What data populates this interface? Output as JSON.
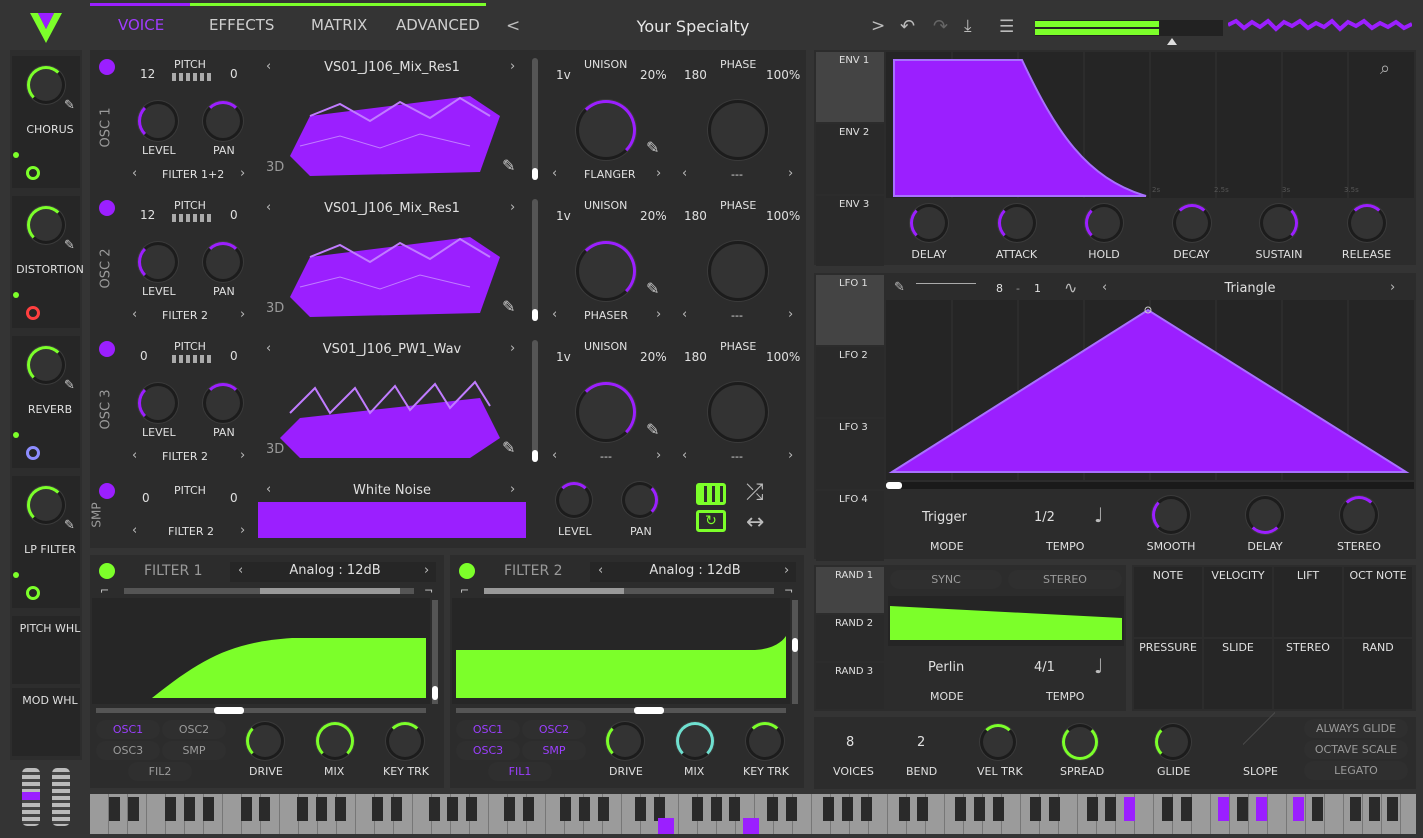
{
  "app": {
    "accent": "#9b1fff",
    "green": "#7cff2a"
  },
  "tabs": [
    "VOICE",
    "EFFECTS",
    "MATRIX",
    "ADVANCED"
  ],
  "preset": {
    "name": "Your Specialty"
  },
  "sidebar": [
    {
      "label": "CHORUS",
      "led": "#7cff2a"
    },
    {
      "label": "DISTORTION",
      "led": "#ff3f3f"
    },
    {
      "label": "REVERB",
      "led": "#8d8dff"
    },
    {
      "label": "LP FILTER",
      "led": "#7cff2a"
    },
    {
      "label": "PITCH WHL"
    },
    {
      "label": "MOD WHL"
    }
  ],
  "oscs": [
    {
      "name": "OSC 1",
      "pitch_left": "12",
      "pitch_right": "0",
      "pitch": "PITCH",
      "level": "LEVEL",
      "pan": "PAN",
      "filter": "FILTER 1+2",
      "wavetable": "VS01_J106_Mix_Res1",
      "view": "3D",
      "unison_voices": "1v",
      "unison": "UNISON",
      "unison_detune": "20%",
      "phase_val": "180",
      "phase": "PHASE",
      "phase_rand": "100%",
      "mod": "FLANGER",
      "phase_mode": "---"
    },
    {
      "name": "OSC 2",
      "pitch_left": "12",
      "pitch_right": "0",
      "pitch": "PITCH",
      "level": "LEVEL",
      "pan": "PAN",
      "filter": "FILTER 2",
      "wavetable": "VS01_J106_Mix_Res1",
      "view": "3D",
      "unison_voices": "1v",
      "unison": "UNISON",
      "unison_detune": "20%",
      "phase_val": "180",
      "phase": "PHASE",
      "phase_rand": "100%",
      "mod": "PHASER",
      "phase_mode": "---"
    },
    {
      "name": "OSC 3",
      "pitch_left": "0",
      "pitch_right": "0",
      "pitch": "PITCH",
      "level": "LEVEL",
      "pan": "PAN",
      "filter": "FILTER 2",
      "wavetable": "VS01_J106_PW1_Wav",
      "view": "3D",
      "unison_voices": "1v",
      "unison": "UNISON",
      "unison_detune": "20%",
      "phase_val": "180",
      "phase": "PHASE",
      "phase_rand": "100%",
      "mod": "---",
      "phase_mode": "---"
    }
  ],
  "smp": {
    "name": "SMP",
    "pitch_left": "0",
    "pitch_right": "0",
    "pitch": "PITCH",
    "filter": "FILTER 2",
    "sample": "White Noise",
    "level": "LEVEL",
    "pan": "PAN"
  },
  "filters": [
    {
      "name": "FILTER 1",
      "model": "Analog : 12dB",
      "src": [
        "OSC1",
        "OSC2",
        "OSC3",
        "SMP",
        "FIL2"
      ],
      "drive": "DRIVE",
      "mix": "MIX",
      "key": "KEY TRK"
    },
    {
      "name": "FILTER 2",
      "model": "Analog : 12dB",
      "src": [
        "OSC1",
        "OSC2",
        "OSC3",
        "SMP",
        "FIL1"
      ],
      "drive": "DRIVE",
      "mix": "MIX",
      "key": "KEY TRK"
    }
  ],
  "env": {
    "tabs": [
      "ENV 1",
      "ENV 2",
      "ENV 3"
    ],
    "knobs": [
      "DELAY",
      "ATTACK",
      "HOLD",
      "DECAY",
      "SUSTAIN",
      "RELEASE"
    ],
    "grid": [
      "2s",
      "2.5s",
      "3s",
      "3.5s"
    ]
  },
  "lfo": {
    "tabs": [
      "LFO 1",
      "LFO 2",
      "LFO 3",
      "LFO 4"
    ],
    "shape": "Triangle",
    "grid_x": "8",
    "dash": "-",
    "grid_y": "1",
    "mode_val": "Trigger",
    "mode": "MODE",
    "tempo_val": "1/2",
    "tempo": "TEMPO",
    "knobs": [
      "SMOOTH",
      "DELAY",
      "STEREO"
    ]
  },
  "rand": {
    "tabs": [
      "RAND 1",
      "RAND 2",
      "RAND 3"
    ],
    "sync": "SYNC",
    "stereo": "STEREO",
    "mode_val": "Perlin",
    "mode": "MODE",
    "tempo_val": "4/1",
    "tempo": "TEMPO"
  },
  "matrix": [
    "NOTE",
    "VELOCITY",
    "LIFT",
    "OCT NOTE",
    "PRESSURE",
    "SLIDE",
    "STEREO",
    "RAND"
  ],
  "voice": {
    "voices_val": "8",
    "voices": "VOICES",
    "bend_val": "2",
    "bend": "BEND",
    "vel": "VEL TRK",
    "spread": "SPREAD",
    "glide": "GLIDE",
    "slope": "SLOPE",
    "buttons": [
      "ALWAYS GLIDE",
      "OCTAVE SCALE",
      "LEGATO"
    ]
  }
}
